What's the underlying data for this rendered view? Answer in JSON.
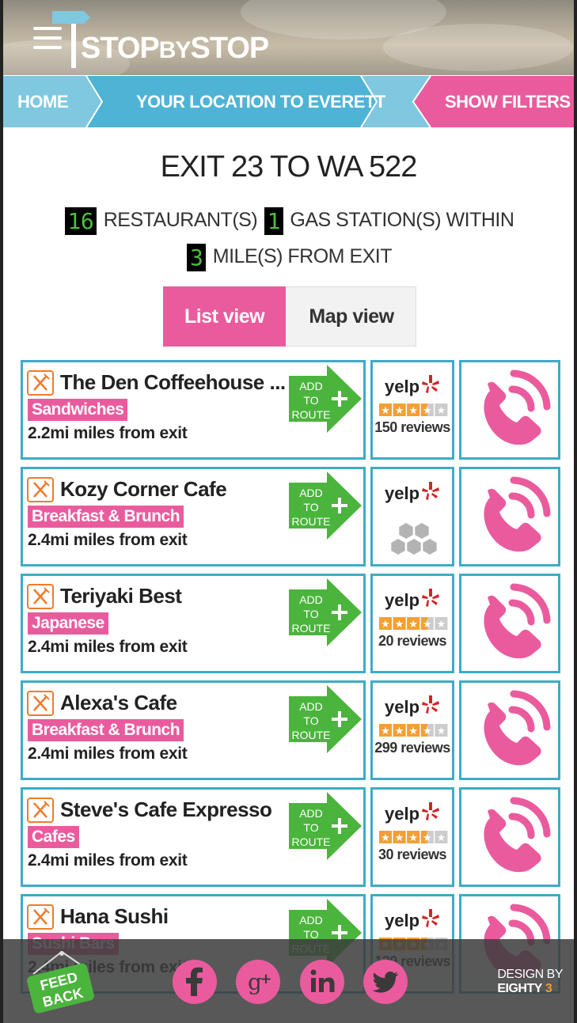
{
  "app": {
    "logo_text_1": "STOP",
    "logo_text_2": "BY",
    "logo_text_3": "STOP"
  },
  "breadcrumbs": {
    "home": "HOME",
    "route": "YOUR LOCATION TO EVERETT",
    "filters": "SHOW FILTERS"
  },
  "page": {
    "title": "EXIT 23 TO WA 522",
    "restaurant_count": "16",
    "restaurant_label": "RESTAURANT(S)",
    "gas_count": "1",
    "gas_label": "GAS STATION(S) WITHIN",
    "miles_count": "3",
    "miles_label": "MILE(S) FROM EXIT"
  },
  "view_toggle": {
    "list_label": "List view",
    "map_label": "Map view",
    "selected": "list"
  },
  "add_route": {
    "line1": "ADD",
    "line2": "TO",
    "line3": "ROUTE"
  },
  "yelp": {
    "logo": "yelp"
  },
  "results": [
    {
      "name": "The Den Coffeehouse ...",
      "category": "Sandwiches",
      "distance": "2.2mi miles from exit",
      "rating": 3.5,
      "reviews": "150 reviews"
    },
    {
      "name": "Kozy Corner Cafe",
      "category": "Breakfast & Brunch",
      "distance": "2.4mi miles from exit",
      "rating": null,
      "reviews": ""
    },
    {
      "name": "Teriyaki Best",
      "category": "Japanese",
      "distance": "2.4mi miles from exit",
      "rating": 3.5,
      "reviews": "20 reviews"
    },
    {
      "name": "Alexa's Cafe",
      "category": "Breakfast & Brunch",
      "distance": "2.4mi miles from exit",
      "rating": 3.5,
      "reviews": "299 reviews"
    },
    {
      "name": "Steve's Cafe Expresso",
      "category": "Cafes",
      "distance": "2.4mi miles from exit",
      "rating": 3.5,
      "reviews": "30 reviews"
    },
    {
      "name": "Hana Sushi",
      "category": "Sushi Bars",
      "distance": "2.4mi miles from exit",
      "rating": 3.5,
      "reviews": "120 reviews"
    }
  ],
  "footer": {
    "feedback_line1": "FEED",
    "feedback_line2": "BACK",
    "design_by": "DESIGN BY",
    "studio": "EIGHTY",
    "studio_num": "3",
    "social": [
      "facebook-icon",
      "google-plus-icon",
      "linkedin-icon",
      "twitter-icon"
    ]
  },
  "colors": {
    "accent_pink": "#ea5b9e",
    "border_blue": "#3eabc7",
    "crumb_blue": "#7fc8e0",
    "route_green": "#4bb43d",
    "orange": "#f07b2b"
  }
}
